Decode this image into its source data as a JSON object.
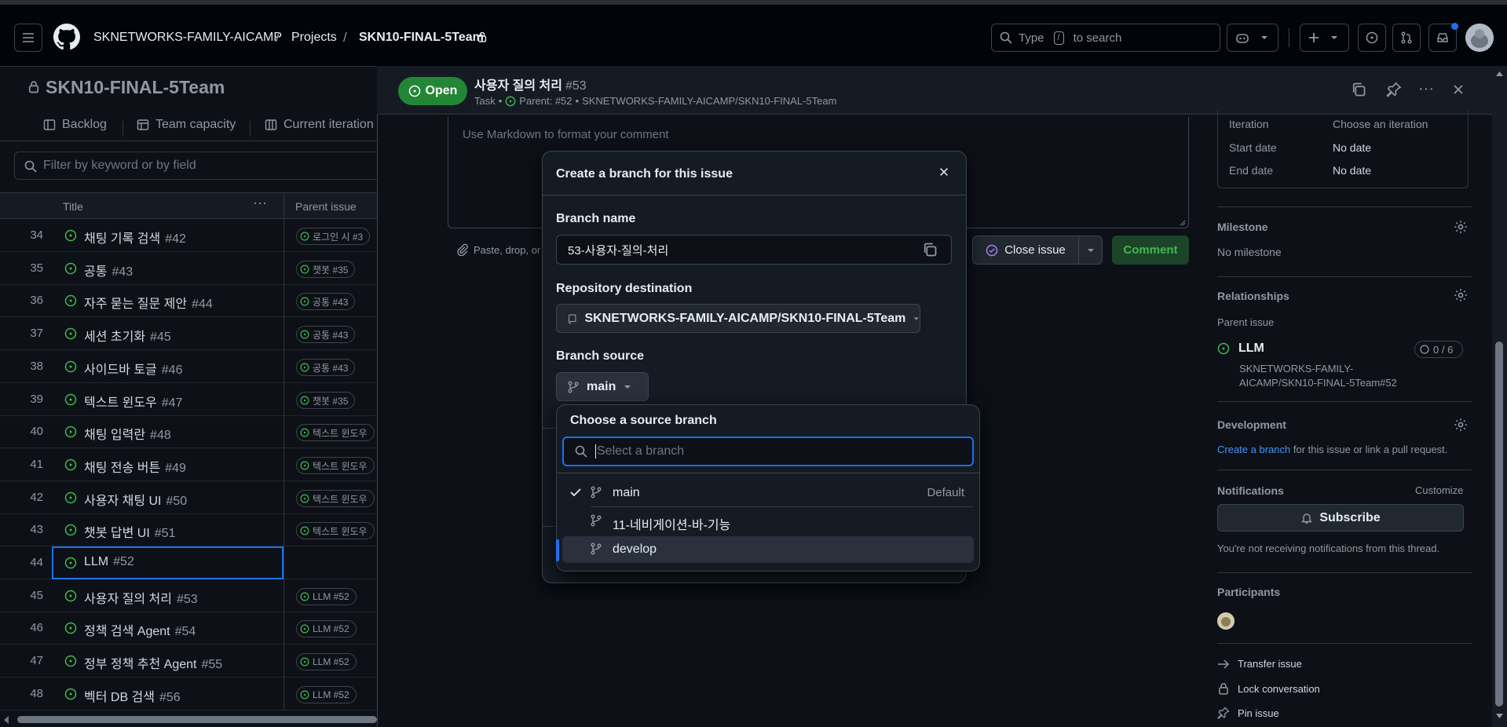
{
  "header": {
    "org": "SKNETWORKS-FAMILY-AICAMP",
    "projects": "Projects",
    "repo": "SKN10-FINAL-5Team",
    "search_prefix": "Type",
    "search_key": "/",
    "search_suffix": "to search"
  },
  "project": {
    "title": "SKN10-FINAL-5Team",
    "tabs": [
      "Backlog",
      "Team capacity",
      "Current iteration"
    ],
    "filter_placeholder": "Filter by keyword or by field",
    "col_title": "Title",
    "col_parent": "Parent issue",
    "rows": [
      {
        "num": "34",
        "title": "채팅 기록 검색",
        "ref": "#42",
        "parent": "로그인 시 #3"
      },
      {
        "num": "35",
        "title": "공통",
        "ref": "#43",
        "parent": "챗봇 #35"
      },
      {
        "num": "36",
        "title": "자주 묻는 질문 제안",
        "ref": "#44",
        "parent": "공통 #43"
      },
      {
        "num": "37",
        "title": "세션 초기화",
        "ref": "#45",
        "parent": "공통 #43"
      },
      {
        "num": "38",
        "title": "사이드바 토글",
        "ref": "#46",
        "parent": "공통 #43"
      },
      {
        "num": "39",
        "title": "텍스트 윈도우",
        "ref": "#47",
        "parent": "챗봇 #35"
      },
      {
        "num": "40",
        "title": "채팅 입력란",
        "ref": "#48",
        "parent": "텍스트 윈도우"
      },
      {
        "num": "41",
        "title": "채팅 전송 버튼",
        "ref": "#49",
        "parent": "텍스트 윈도우"
      },
      {
        "num": "42",
        "title": "사용자 채팅 UI",
        "ref": "#50",
        "parent": "텍스트 윈도우"
      },
      {
        "num": "43",
        "title": "챗봇 답변 UI",
        "ref": "#51",
        "parent": "텍스트 윈도우"
      },
      {
        "num": "44",
        "title": "LLM",
        "ref": "#52",
        "parent": ""
      },
      {
        "num": "45",
        "title": "사용자 질의 처리",
        "ref": "#53",
        "parent": "LLM #52"
      },
      {
        "num": "46",
        "title": "정책 검색 Agent",
        "ref": "#54",
        "parent": "LLM #52"
      },
      {
        "num": "47",
        "title": "정부 정책 추천 Agent",
        "ref": "#55",
        "parent": "LLM #52"
      },
      {
        "num": "48",
        "title": "벡터 DB 검색",
        "ref": "#56",
        "parent": "LLM #52"
      }
    ]
  },
  "issue": {
    "state": "Open",
    "title": "사용자 질의 처리",
    "number": "#53",
    "type": "Task",
    "parent_prefix": "Parent: #52",
    "parent_repo": "SKNETWORKS-FAMILY-AICAMP/SKN10-FINAL-5Team",
    "comment_placeholder": "Use Markdown to format your comment",
    "attach_text": "Paste, drop, or",
    "close_button": "Close issue",
    "comment_button": "Comment"
  },
  "sidebar": {
    "iteration_label": "Iteration",
    "iteration_value": "Choose an iteration",
    "start_label": "Start date",
    "start_value": "No date",
    "end_label": "End date",
    "end_value": "No date",
    "milestone_head": "Milestone",
    "milestone_value": "No milestone",
    "relationships_head": "Relationships",
    "parent_label": "Parent issue",
    "parent_title": "LLM",
    "parent_progress": "0 / 6",
    "parent_repo_line1": "SKNETWORKS-FAMILY-",
    "parent_repo_line2": "AICAMP/SKN10-FINAL-5Team#52",
    "development_head": "Development",
    "create_branch_link": "Create a branch",
    "development_text": "for this issue or link a pull request.",
    "notifications_head": "Notifications",
    "customize": "Customize",
    "subscribe": "Subscribe",
    "notif_text": "You're not receiving notifications from this thread.",
    "participants_head": "Participants",
    "transfer": "Transfer issue",
    "lock": "Lock conversation",
    "pin": "Pin issue"
  },
  "dialog": {
    "title": "Create a branch for this issue",
    "branch_name_label": "Branch name",
    "branch_name_value": "53-사용자-질의-처리",
    "repo_dest_label": "Repository destination",
    "repo_dest_value": "SKNETWORKS-FAMILY-AICAMP/SKN10-FINAL-5Team",
    "branch_source_label": "Branch source",
    "branch_source_value": "main"
  },
  "dropdown": {
    "title": "Choose a source branch",
    "search_placeholder": "Select a branch",
    "items": [
      {
        "name": "main",
        "badge": "Default"
      },
      {
        "name": "11-네비게이션-바-기능",
        "badge": ""
      },
      {
        "name": "develop",
        "badge": ""
      }
    ]
  },
  "colors": {
    "accent": "#1f6feb",
    "open_green": "#238636",
    "status_green": "#3fb950",
    "bg": "#0d1117"
  }
}
